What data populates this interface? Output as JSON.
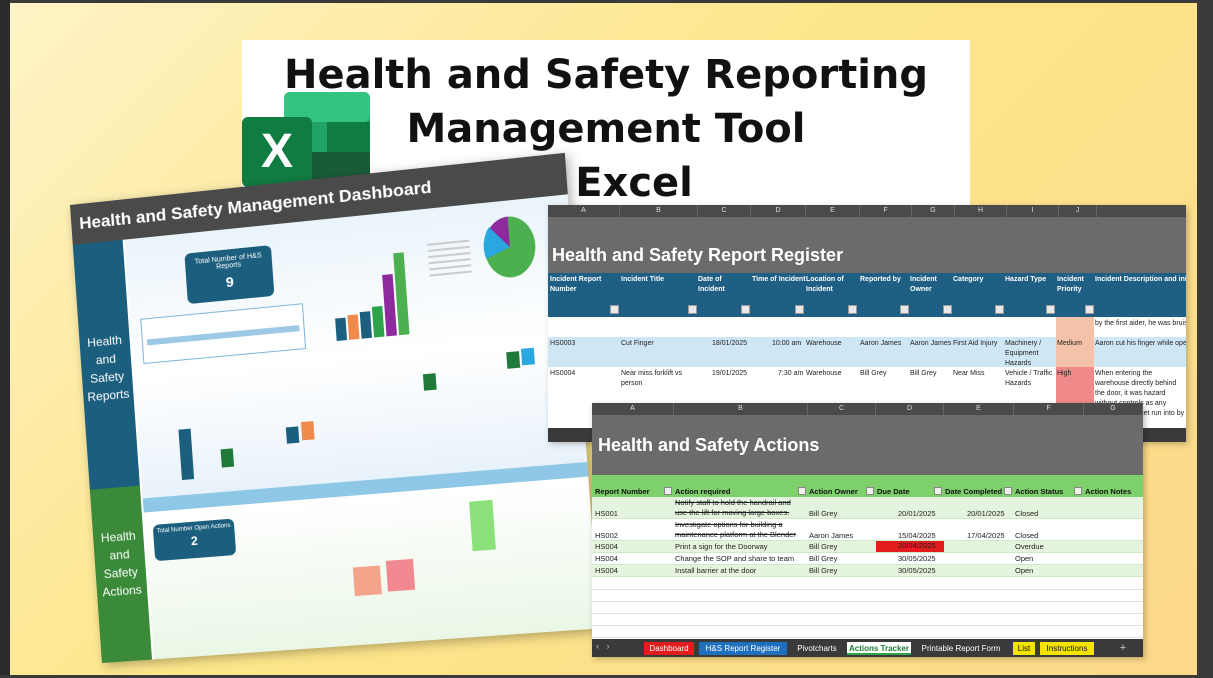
{
  "title_card": {
    "line1": "Health and Safety Reporting",
    "line2": "Management Tool",
    "line3": "in Excel",
    "logo_icon": "excel-logo-icon",
    "logo_letter": "X"
  },
  "dashboard": {
    "title": "Health and Safety Management Dashboard",
    "side_reports": "Health and Safety Reports",
    "side_actions": "Health and Safety Actions",
    "kpi_reports_label": "Total Number of H&S Reports",
    "kpi_reports_value": "9",
    "kpi_actions_label": "Total Number Open Actions",
    "kpi_actions_value": "2"
  },
  "register": {
    "columns": [
      "A",
      "B",
      "C",
      "D",
      "E",
      "F",
      "G",
      "H",
      "I",
      "J"
    ],
    "title": "Health and Safety Report Register",
    "headers": {
      "report_number": "Incident Report Number",
      "incident_title": "Incident Title",
      "date": "Date of Incident",
      "time": "Time of Incident",
      "location": "Location of Incident",
      "reported_by": "Reported by",
      "owner": "Incident Owner",
      "category": "Category",
      "hazard": "Hazard Type",
      "priority": "Incident Priority",
      "description": "Incident Description and initi"
    },
    "row_partial_desc": "by the first aider, he was bruise",
    "rows": [
      {
        "number": "HS0003",
        "title": "Cut Finger",
        "date": "18/01/2025",
        "time": "10:00 am",
        "location": "Warehouse",
        "reported_by": "Aaron James",
        "owner": "Aaron James",
        "category": "First Aid Injury",
        "hazard": "Machinery / Equipment Hazards",
        "priority": "Medium",
        "description": "Aaron cut his finger while oper"
      },
      {
        "number": "HS0004",
        "title": "Near miss forklift vs person",
        "date": "19/01/2025",
        "time": "7:30 am",
        "location": "Warehouse",
        "reported_by": "Bill Grey",
        "owner": "Bill Grey",
        "category": "Near Miss",
        "hazard": "Vehicle / Traffic Hazards",
        "priority": "High",
        "description": "When entering the warehouse directly behind the door, it was hazard without controls as any thinking could get run into by a ntil a more per"
      }
    ]
  },
  "actions": {
    "columns": [
      "A",
      "B",
      "C",
      "D",
      "E",
      "F",
      "G"
    ],
    "title": "Health and Safety Actions",
    "headers": {
      "report_number": "Report Number",
      "action_required": "Action required",
      "owner": "Action Owner",
      "due": "Due Date",
      "completed": "Date Completed",
      "status": "Action Status",
      "notes": "Action Notes"
    },
    "rows": [
      {
        "number": "HS001",
        "action1": "Notify staff to hold the handrail and",
        "action2": "use the lift for moving large boxes.",
        "owner": "Bill Grey",
        "due": "20/01/2025",
        "completed": "20/01/2025",
        "status": "Closed"
      },
      {
        "number": "HS002",
        "action1": "Investigate options for building a",
        "action2": "maintenance platform at the Blender",
        "owner": "Aaron James",
        "due": "15/04/2025",
        "completed": "17/04/2025",
        "status": "Closed"
      },
      {
        "number": "HS004",
        "action1": "Print a sign for the Doorway",
        "action2": "",
        "owner": "Bill Grey",
        "due": "20/04/2025",
        "completed": "",
        "status": "Overdue"
      },
      {
        "number": "HS004",
        "action1": "Change the SOP and share to team",
        "action2": "",
        "owner": "Bill Grey",
        "due": "30/05/2025",
        "completed": "",
        "status": "Open"
      },
      {
        "number": "HS004",
        "action1": "Install barrier at the door",
        "action2": "",
        "owner": "Bill Grey",
        "due": "30/05/2025",
        "completed": "",
        "status": "Open"
      }
    ],
    "tabs": [
      {
        "label": "Dashboard",
        "color": "#e11d1d"
      },
      {
        "label": "H&S Report Register",
        "color": "#1f6fbf"
      },
      {
        "label": "Pivotcharts",
        "color": ""
      },
      {
        "label": "Actions Tracker",
        "color": "#ffffff"
      },
      {
        "label": "Printable Report Form",
        "color": ""
      },
      {
        "label": "List",
        "color": "#f5e400"
      },
      {
        "label": "Instructions",
        "color": "#f5e400"
      }
    ],
    "add_sheet": "+"
  }
}
